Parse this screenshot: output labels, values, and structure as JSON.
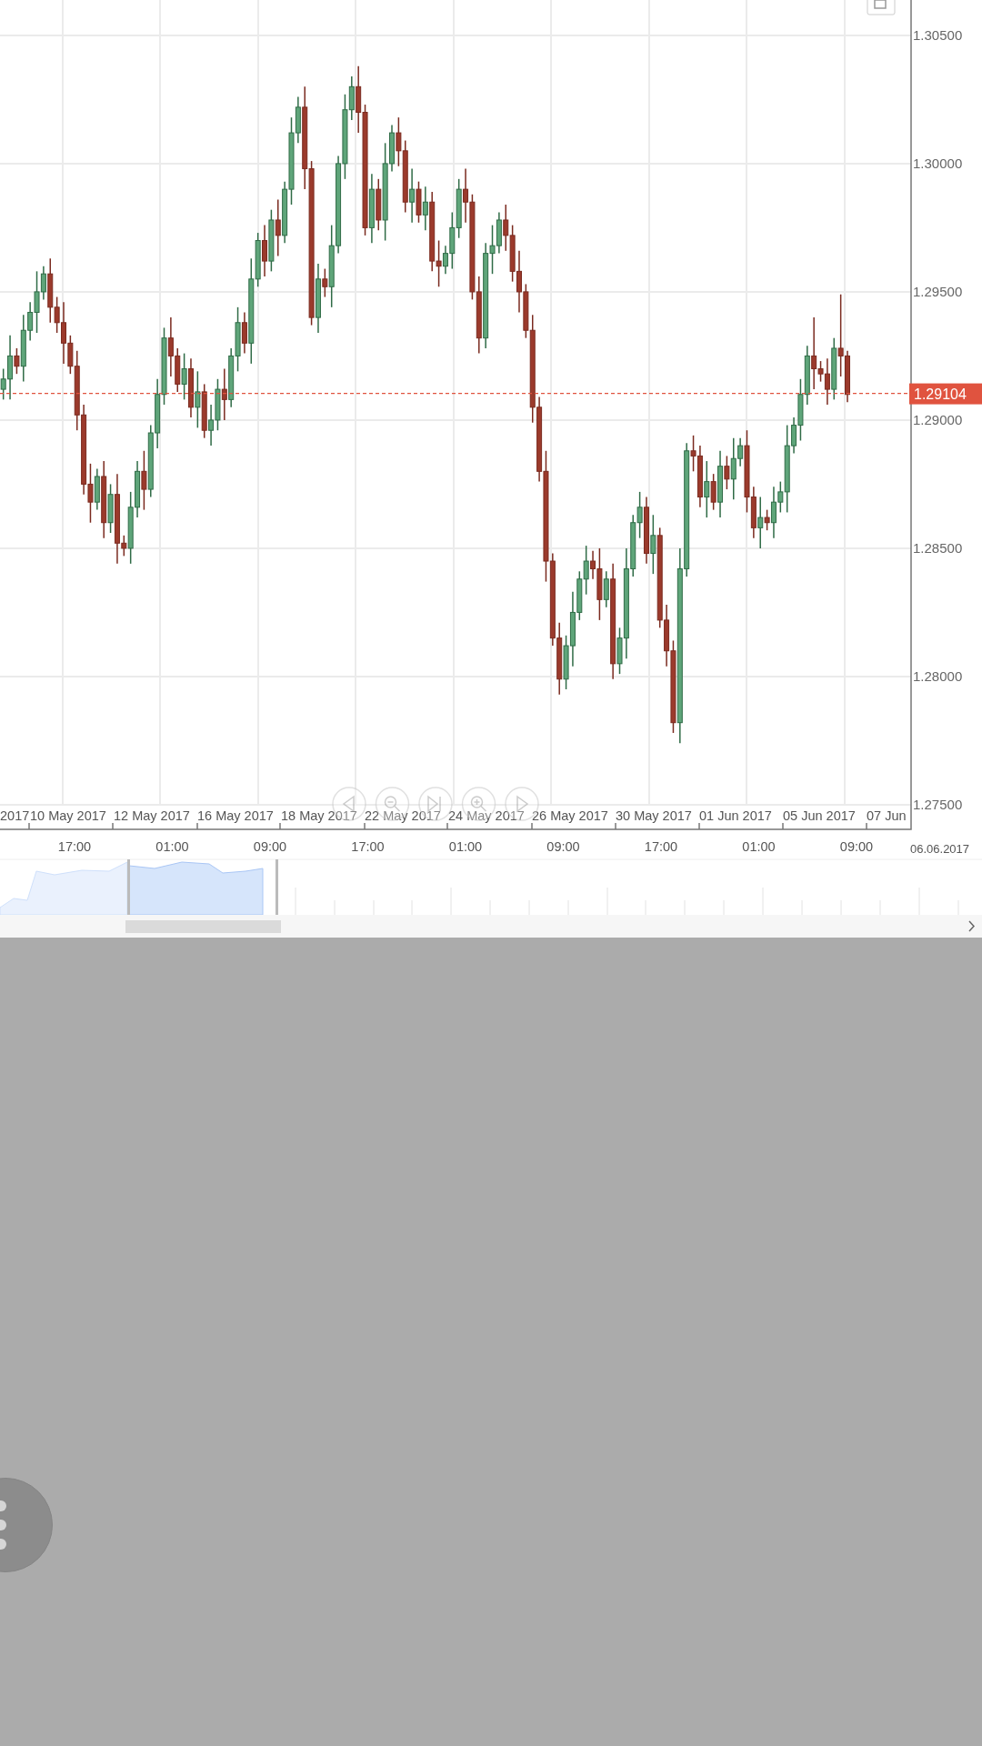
{
  "chart": {
    "chart_data": {
      "type": "candlestick",
      "yticks": [
        {
          "value": 1.305,
          "label": "1.30500"
        },
        {
          "value": 1.3,
          "label": "1.30000"
        },
        {
          "value": 1.295,
          "label": "1.29500"
        },
        {
          "value": 1.29,
          "label": "1.29000"
        },
        {
          "value": 1.285,
          "label": "1.28500"
        },
        {
          "value": 1.28,
          "label": "1.28000"
        },
        {
          "value": 1.275,
          "label": "1.27500"
        }
      ],
      "ylim": [
        1.27404,
        1.30638
      ],
      "grid": true,
      "ref_lines": [
        {
          "axis": "y",
          "value": 1.29104,
          "label": "1.29104",
          "color": "#e0533f"
        }
      ],
      "categories": [
        null,
        null,
        null,
        null,
        null,
        null,
        null,
        null,
        null,
        null,
        null,
        null,
        null,
        null,
        null,
        null,
        null,
        null,
        null,
        null,
        null,
        null,
        null,
        null,
        null,
        null,
        null,
        null,
        null,
        null,
        null,
        null,
        null,
        null,
        null,
        null,
        null,
        null,
        null,
        null,
        null,
        null,
        null,
        null,
        null,
        null,
        null,
        null,
        null,
        null,
        null,
        null,
        null,
        null,
        null,
        null,
        null,
        null,
        null,
        null,
        null,
        null,
        null,
        null,
        null,
        null,
        null,
        null,
        null,
        null,
        null,
        null,
        null,
        null,
        null,
        null,
        null,
        null,
        null,
        null,
        null,
        null,
        null,
        null,
        null,
        null,
        null,
        null,
        null,
        null,
        null,
        null,
        null,
        null,
        null,
        null,
        null,
        null,
        null,
        null,
        null,
        null,
        null,
        null,
        null,
        null,
        null,
        null,
        null,
        null,
        null,
        null,
        null,
        null,
        null,
        null,
        null,
        null,
        null,
        null,
        null,
        null,
        null,
        null,
        null,
        null,
        null,
        null,
        null,
        null,
        null,
        null,
        null,
        null,
        null,
        null
      ],
      "ohlc": [
        [
          1.2912,
          1.292,
          1.2908,
          1.2916
        ],
        [
          1.2916,
          1.2933,
          1.2908,
          1.2925
        ],
        [
          1.2925,
          1.2928,
          1.2918,
          1.2921
        ],
        [
          1.2921,
          1.2941,
          1.2915,
          1.2935
        ],
        [
          1.2935,
          1.2946,
          1.2931,
          1.2942
        ],
        [
          1.2942,
          1.2958,
          1.2934,
          1.295
        ],
        [
          1.295,
          1.296,
          1.2947,
          1.2957
        ],
        [
          1.2957,
          1.2963,
          1.2938,
          1.2944
        ],
        [
          1.2944,
          1.2948,
          1.2934,
          1.2938
        ],
        [
          1.2938,
          1.2946,
          1.2922,
          1.293
        ],
        [
          1.293,
          1.2933,
          1.2918,
          1.2921
        ],
        [
          1.2921,
          1.2927,
          1.2896,
          1.2902
        ],
        [
          1.2902,
          1.2906,
          1.2871,
          1.2875
        ],
        [
          1.2875,
          1.2883,
          1.286,
          1.2868
        ],
        [
          1.2868,
          1.2881,
          1.2865,
          1.2878
        ],
        [
          1.2878,
          1.2884,
          1.2854,
          1.286
        ],
        [
          1.286,
          1.2875,
          1.2856,
          1.2871
        ],
        [
          1.2871,
          1.2879,
          1.2844,
          1.2852
        ],
        [
          1.2852,
          1.2855,
          1.2847,
          1.285
        ],
        [
          1.285,
          1.2872,
          1.2844,
          1.2866
        ],
        [
          1.2866,
          1.2884,
          1.2862,
          1.288
        ],
        [
          1.288,
          1.2888,
          1.2865,
          1.2873
        ],
        [
          1.2873,
          1.2898,
          1.287,
          1.2895
        ],
        [
          1.2895,
          1.2916,
          1.2889,
          1.291
        ],
        [
          1.291,
          1.2936,
          1.2906,
          1.2932
        ],
        [
          1.2932,
          1.294,
          1.2917,
          1.2925
        ],
        [
          1.2925,
          1.2928,
          1.2911,
          1.2914
        ],
        [
          1.2914,
          1.2926,
          1.2908,
          1.292
        ],
        [
          1.292,
          1.2924,
          1.2901,
          1.2905
        ],
        [
          1.2905,
          1.2919,
          1.2897,
          1.2911
        ],
        [
          1.2911,
          1.2914,
          1.2893,
          1.2896
        ],
        [
          1.2896,
          1.2906,
          1.289,
          1.29
        ],
        [
          1.29,
          1.2916,
          1.2896,
          1.2912
        ],
        [
          1.2912,
          1.292,
          1.29,
          1.2908
        ],
        [
          1.2908,
          1.2928,
          1.2905,
          1.2925
        ],
        [
          1.2925,
          1.2944,
          1.2919,
          1.2938
        ],
        [
          1.2938,
          1.2942,
          1.2926,
          1.293
        ],
        [
          1.293,
          1.2963,
          1.2922,
          1.2955
        ],
        [
          1.2955,
          1.2973,
          1.2952,
          1.297
        ],
        [
          1.297,
          1.2976,
          1.2956,
          1.2962
        ],
        [
          1.2962,
          1.2982,
          1.2958,
          1.2978
        ],
        [
          1.2978,
          1.2986,
          1.2964,
          1.2972
        ],
        [
          1.2972,
          1.2993,
          1.2969,
          1.299
        ],
        [
          1.299,
          1.3018,
          1.2984,
          1.3012
        ],
        [
          1.3012,
          1.3026,
          1.3008,
          1.3022
        ],
        [
          1.3022,
          1.303,
          1.299,
          1.2998
        ],
        [
          1.2998,
          1.3001,
          1.2937,
          1.294
        ],
        [
          1.294,
          1.2961,
          1.2934,
          1.2955
        ],
        [
          1.2955,
          1.2959,
          1.2948,
          1.2952
        ],
        [
          1.2952,
          1.2976,
          1.2944,
          1.2968
        ],
        [
          1.2968,
          1.3003,
          1.2965,
          1.3
        ],
        [
          1.3,
          1.3027,
          1.2994,
          1.3021
        ],
        [
          1.3021,
          1.3034,
          1.3017,
          1.303
        ],
        [
          1.303,
          1.3038,
          1.3012,
          1.302
        ],
        [
          1.302,
          1.3023,
          1.2972,
          1.2975
        ],
        [
          1.2975,
          1.2996,
          1.2969,
          1.299
        ],
        [
          1.299,
          1.2994,
          1.2974,
          1.2978
        ],
        [
          1.2978,
          1.3008,
          1.297,
          1.3
        ],
        [
          1.3,
          1.3015,
          1.2997,
          1.3012
        ],
        [
          1.3012,
          1.3018,
          1.2999,
          1.3005
        ],
        [
          1.3005,
          1.3009,
          1.2981,
          1.2985
        ],
        [
          1.2985,
          1.2998,
          1.2977,
          1.299
        ],
        [
          1.299,
          1.2993,
          1.2977,
          1.298
        ],
        [
          1.298,
          1.2991,
          1.2974,
          1.2985
        ],
        [
          1.2985,
          1.2989,
          1.2958,
          1.2962
        ],
        [
          1.2962,
          1.297,
          1.2952,
          1.296
        ],
        [
          1.296,
          1.2968,
          1.2957,
          1.2965
        ],
        [
          1.2965,
          1.2981,
          1.2959,
          1.2975
        ],
        [
          1.2975,
          1.2994,
          1.2971,
          1.299
        ],
        [
          1.299,
          1.2998,
          1.2977,
          1.2985
        ],
        [
          1.2985,
          1.2988,
          1.2947,
          1.295
        ],
        [
          1.295,
          1.2956,
          1.2926,
          1.2932
        ],
        [
          1.2932,
          1.2969,
          1.2928,
          1.2965
        ],
        [
          1.2965,
          1.2976,
          1.2957,
          1.2968
        ],
        [
          1.2968,
          1.2981,
          1.2965,
          1.2978
        ],
        [
          1.2978,
          1.2984,
          1.2966,
          1.2972
        ],
        [
          1.2972,
          1.2976,
          1.2954,
          1.2958
        ],
        [
          1.2958,
          1.2966,
          1.2942,
          1.295
        ],
        [
          1.295,
          1.2953,
          1.2932,
          1.2935
        ],
        [
          1.2935,
          1.2941,
          1.2899,
          1.2905
        ],
        [
          1.2905,
          1.2909,
          1.2876,
          1.288
        ],
        [
          1.288,
          1.2888,
          1.2837,
          1.2845
        ],
        [
          1.2845,
          1.2848,
          1.2812,
          1.2815
        ],
        [
          1.2815,
          1.2821,
          1.2793,
          1.2799
        ],
        [
          1.2799,
          1.2816,
          1.2795,
          1.2812
        ],
        [
          1.2812,
          1.2833,
          1.2804,
          1.2825
        ],
        [
          1.2825,
          1.2841,
          1.2822,
          1.2838
        ],
        [
          1.2838,
          1.2851,
          1.2832,
          1.2845
        ],
        [
          1.2845,
          1.2849,
          1.2838,
          1.2842
        ],
        [
          1.2842,
          1.285,
          1.2822,
          1.283
        ],
        [
          1.283,
          1.2841,
          1.2827,
          1.2838
        ],
        [
          1.2838,
          1.2844,
          1.2799,
          1.2805
        ],
        [
          1.2805,
          1.2819,
          1.2801,
          1.2815
        ],
        [
          1.2815,
          1.285,
          1.2807,
          1.2842
        ],
        [
          1.2842,
          1.2863,
          1.2839,
          1.286
        ],
        [
          1.286,
          1.2872,
          1.2854,
          1.2866
        ],
        [
          1.2866,
          1.287,
          1.2844,
          1.2848
        ],
        [
          1.2848,
          1.2863,
          1.284,
          1.2855
        ],
        [
          1.2855,
          1.2858,
          1.2819,
          1.2822
        ],
        [
          1.2822,
          1.2828,
          1.2804,
          1.281
        ],
        [
          1.281,
          1.2814,
          1.2778,
          1.2782
        ],
        [
          1.2782,
          1.285,
          1.2774,
          1.2842
        ],
        [
          1.2842,
          1.2891,
          1.2839,
          1.2888
        ],
        [
          1.2888,
          1.2894,
          1.288,
          1.2886
        ],
        [
          1.2886,
          1.289,
          1.2866,
          1.287
        ],
        [
          1.287,
          1.2884,
          1.2862,
          1.2876
        ],
        [
          1.2876,
          1.2879,
          1.2865,
          1.2868
        ],
        [
          1.2868,
          1.2888,
          1.2862,
          1.2882
        ],
        [
          1.2882,
          1.2886,
          1.2873,
          1.2877
        ],
        [
          1.2877,
          1.2893,
          1.2869,
          1.2885
        ],
        [
          1.2885,
          1.2893,
          1.2882,
          1.289
        ],
        [
          1.289,
          1.2896,
          1.2864,
          1.287
        ],
        [
          1.287,
          1.2874,
          1.2854,
          1.2858
        ],
        [
          1.2858,
          1.287,
          1.285,
          1.2862
        ],
        [
          1.2862,
          1.2865,
          1.2857,
          1.286
        ],
        [
          1.286,
          1.2874,
          1.2854,
          1.2868
        ],
        [
          1.2868,
          1.2876,
          1.2864,
          1.2872
        ],
        [
          1.2872,
          1.2898,
          1.2864,
          1.289
        ],
        [
          1.289,
          1.2901,
          1.2887,
          1.2898
        ],
        [
          1.2898,
          1.2916,
          1.2892,
          1.291
        ],
        [
          1.291,
          1.2929,
          1.2906,
          1.2925
        ],
        [
          1.2925,
          1.294,
          1.2912,
          1.292
        ],
        [
          1.292,
          1.2923,
          1.2915,
          1.2918
        ],
        [
          1.2918,
          1.2924,
          1.2906,
          1.2912
        ],
        [
          1.2912,
          1.2932,
          1.2908,
          1.2928
        ],
        [
          1.2928,
          1.2949,
          1.2917,
          1.2925
        ],
        [
          1.2925,
          1.2927,
          1.2907,
          1.291
        ],
        null,
        null,
        null,
        null,
        null,
        null,
        null,
        null,
        null
      ]
    },
    "date_labels": [
      "2017",
      "10 May 2017",
      "12 May 2017",
      "16 May 2017",
      "18 May 2017",
      "22 May 2017",
      "24 May 2017",
      "26 May 2017",
      "30 May 2017",
      "01 Jun 2017",
      "05 Jun 2017",
      "07 Jun"
    ],
    "time_labels": [
      "17:00",
      "01:00",
      "09:00",
      "17:00",
      "01:00",
      "09:00",
      "17:00",
      "01:00",
      "09:00"
    ],
    "navigator_date": "06.06.2017"
  }
}
